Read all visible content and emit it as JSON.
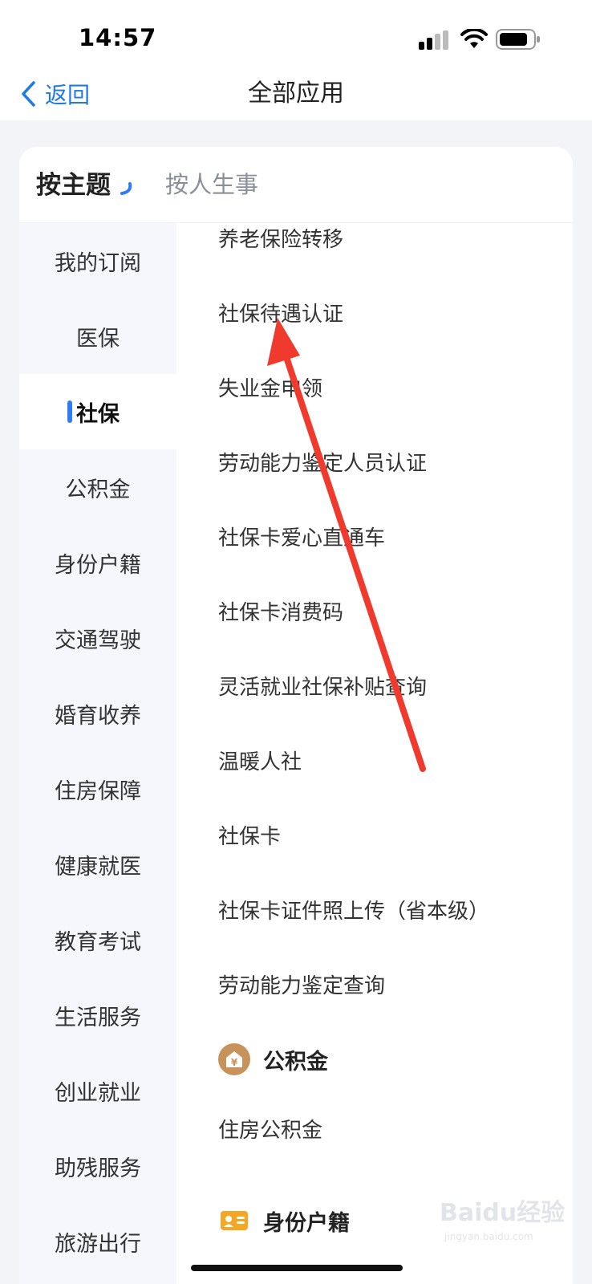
{
  "status_bar": {
    "time": "14:57"
  },
  "nav": {
    "back_label": "返回",
    "title": "全部应用"
  },
  "tabs": {
    "theme": "按主题",
    "life_event": "按人生事"
  },
  "sidebar": {
    "items": [
      {
        "label": "我的订阅"
      },
      {
        "label": "医保"
      },
      {
        "label": "社保",
        "active": true
      },
      {
        "label": "公积金"
      },
      {
        "label": "身份户籍"
      },
      {
        "label": "交通驾驶"
      },
      {
        "label": "婚育收养"
      },
      {
        "label": "住房保障"
      },
      {
        "label": "健康就医"
      },
      {
        "label": "教育考试"
      },
      {
        "label": "生活服务"
      },
      {
        "label": "创业就业"
      },
      {
        "label": "助残服务"
      },
      {
        "label": "旅游出行"
      }
    ]
  },
  "content": {
    "social_security_items": [
      "养老保险转移",
      "社保待遇认证",
      "失业金申领",
      "劳动能力鉴定人员认证",
      "社保卡爱心直通车",
      "社保卡消费码",
      "灵活就业社保补贴查询",
      "温暖人社",
      "社保卡",
      "社保卡证件照上传（省本级）",
      "劳动能力鉴定查询"
    ],
    "housing_fund_section": {
      "title": "公积金",
      "icon": "house-yuan-icon",
      "icon_color": "#c8935a",
      "items": [
        "住房公积金"
      ]
    },
    "identity_section": {
      "title": "身份户籍",
      "icon": "id-card-icon",
      "icon_color": "#f5a623"
    }
  },
  "colors": {
    "accent": "#1f7ae8",
    "active_indicator": "#2f7cf6",
    "annotation_arrow": "#f03a2e"
  },
  "watermark": {
    "logo": "Baidu经验",
    "site": "jingyan.baidu.com"
  }
}
